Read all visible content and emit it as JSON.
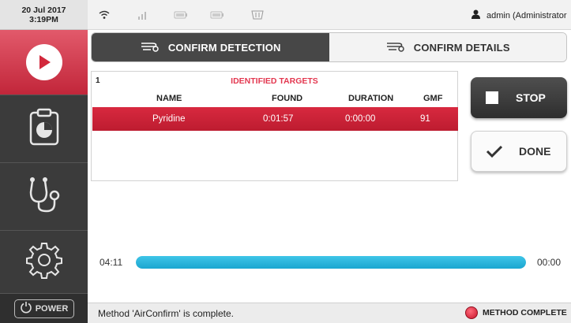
{
  "datetime": {
    "date": "20 Jul 2017",
    "time": "3:19PM"
  },
  "statusbar": {
    "icons": [
      "wifi-icon",
      "signal-icon",
      "battery-icon",
      "battery-icon",
      "storage-icon"
    ],
    "user": "admin (Administrator"
  },
  "nav": {
    "items": [
      "play-icon",
      "clipboard-chart-icon",
      "stethoscope-icon",
      "gear-icon"
    ],
    "power_label": "POWER"
  },
  "tabs": [
    {
      "label": "CONFIRM DETECTION",
      "active": true
    },
    {
      "label": "CONFIRM DETAILS",
      "active": false
    }
  ],
  "targets": {
    "count": "1",
    "title": "IDENTIFIED TARGETS",
    "columns": [
      "NAME",
      "FOUND",
      "DURATION",
      "GMF"
    ],
    "rows": [
      {
        "name": "Pyridine",
        "found": "0:01:57",
        "duration": "0:00:00",
        "gmf": "91"
      }
    ]
  },
  "actions": {
    "stop_label": "STOP",
    "done_label": "DONE"
  },
  "progress": {
    "elapsed": "04:11",
    "remaining": "00:00",
    "fraction": 1.0
  },
  "footer": {
    "message": "Method 'AirConfirm' is complete.",
    "status": "METHOD COMPLETE"
  },
  "colors": {
    "accent_red": "#d8293f",
    "progress_blue": "#2bb6de",
    "nav_dark": "#3b3b3b"
  }
}
